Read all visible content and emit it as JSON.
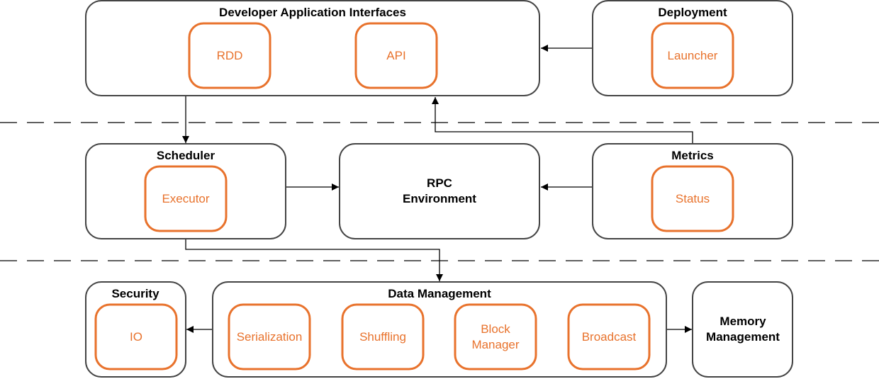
{
  "colors": {
    "component": "#E8722C",
    "group_border": "#444444",
    "arrow": "#000000"
  },
  "groups": {
    "developer": {
      "title": "Developer Application Interfaces",
      "items": [
        "RDD",
        "API"
      ]
    },
    "deployment": {
      "title": "Deployment",
      "items": [
        "Launcher"
      ]
    },
    "scheduler": {
      "title": "Scheduler",
      "items": [
        "Executor"
      ]
    },
    "rpc": {
      "title_line1": "RPC",
      "title_line2": "Environment"
    },
    "metrics": {
      "title": "Metrics",
      "items": [
        "Status"
      ]
    },
    "security": {
      "title": "Security",
      "items": [
        "IO"
      ]
    },
    "data_management": {
      "title": "Data Management",
      "items": [
        "Serialization",
        "Shuffling",
        "Block",
        "Manager",
        "Broadcast"
      ]
    },
    "memory": {
      "title_line1": "Memory",
      "title_line2": "Management"
    }
  },
  "edges": [
    [
      "Deployment",
      "Developer Application Interfaces"
    ],
    [
      "Developer Application Interfaces",
      "Scheduler"
    ],
    [
      "Scheduler",
      "RPC Environment"
    ],
    [
      "Metrics",
      "RPC Environment"
    ],
    [
      "Metrics",
      "Developer Application Interfaces"
    ],
    [
      "Scheduler",
      "Data Management"
    ],
    [
      "Data Management",
      "Security"
    ],
    [
      "Data Management",
      "Memory Management"
    ]
  ]
}
